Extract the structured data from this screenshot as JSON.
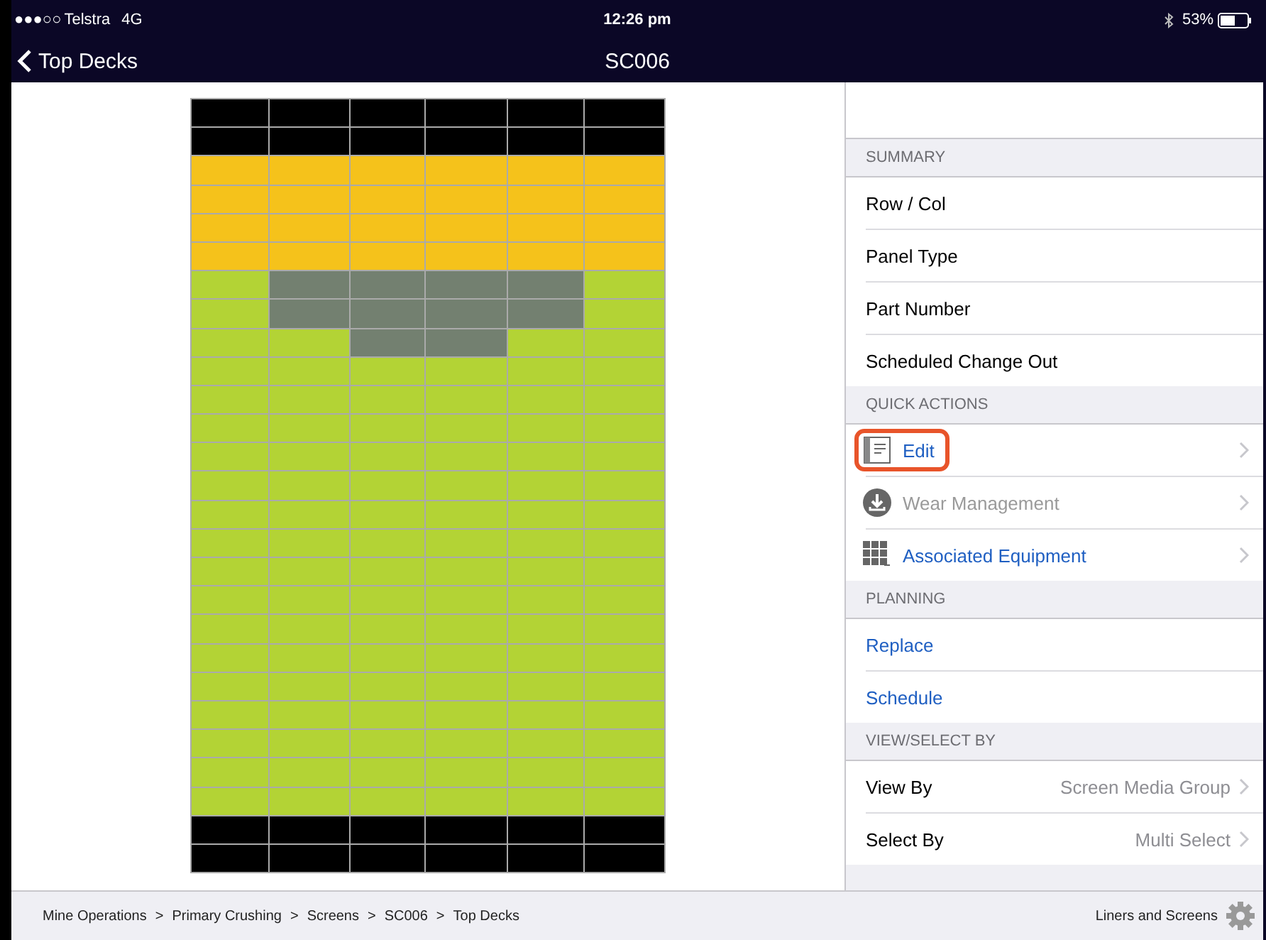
{
  "status_bar": {
    "signal": "●●●○○",
    "carrier": "Telstra",
    "network": "4G",
    "time": "12:26 pm",
    "battery": "53%"
  },
  "nav_bar": {
    "back": "Top Decks",
    "title": "SC006"
  },
  "deck_grid": {
    "rows": [
      {
        "cells": [
          {
            "color": "#000000"
          },
          {
            "color": "#000000"
          },
          {
            "color": "#000000"
          },
          {
            "color": "#000000"
          },
          {
            "color": "#000000"
          },
          {
            "color": "#000000"
          }
        ]
      },
      {
        "cells": [
          {
            "color": "#000000"
          },
          {
            "color": "#000000"
          },
          {
            "color": "#000000"
          },
          {
            "color": "#000000"
          },
          {
            "color": "#000000"
          },
          {
            "color": "#000000"
          }
        ]
      },
      {
        "cells": [
          {
            "color": "#f5c21b"
          },
          {
            "color": "#f5c21b"
          },
          {
            "color": "#f5c21b"
          },
          {
            "color": "#f5c21b"
          },
          {
            "color": "#f5c21b"
          },
          {
            "color": "#f5c21b"
          }
        ]
      },
      {
        "cells": [
          {
            "color": "#f5c21b"
          },
          {
            "color": "#f5c21b"
          },
          {
            "color": "#f5c21b"
          },
          {
            "color": "#f5c21b"
          },
          {
            "color": "#f5c21b"
          },
          {
            "color": "#f5c21b"
          }
        ]
      },
      {
        "cells": [
          {
            "color": "#f5c21b"
          },
          {
            "color": "#f5c21b"
          },
          {
            "color": "#f5c21b"
          },
          {
            "color": "#f5c21b"
          },
          {
            "color": "#f5c21b"
          },
          {
            "color": "#f5c21b"
          }
        ]
      },
      {
        "cells": [
          {
            "color": "#f5c21b"
          },
          {
            "color": "#f5c21b"
          },
          {
            "color": "#f5c21b"
          },
          {
            "color": "#f5c21b"
          },
          {
            "color": "#f5c21b"
          },
          {
            "color": "#f5c21b"
          }
        ]
      },
      {
        "cells": [
          {
            "color": "#b3d335"
          },
          {
            "color": "#738070"
          },
          {
            "color": "#738070"
          },
          {
            "color": "#738070"
          },
          {
            "color": "#738070"
          },
          {
            "color": "#b3d335"
          }
        ]
      },
      {
        "cells": [
          {
            "color": "#b3d335"
          },
          {
            "color": "#738070"
          },
          {
            "color": "#738070"
          },
          {
            "color": "#738070"
          },
          {
            "color": "#738070"
          },
          {
            "color": "#b3d335"
          }
        ]
      },
      {
        "cells": [
          {
            "color": "#b3d335"
          },
          {
            "color": "#b3d335"
          },
          {
            "color": "#738070"
          },
          {
            "color": "#738070"
          },
          {
            "color": "#b3d335"
          },
          {
            "color": "#b3d335"
          }
        ]
      },
      {
        "cells": [
          {
            "color": "#b3d335"
          },
          {
            "color": "#b3d335"
          },
          {
            "color": "#b3d335"
          },
          {
            "color": "#b3d335"
          },
          {
            "color": "#b3d335"
          },
          {
            "color": "#b3d335"
          }
        ]
      },
      {
        "cells": [
          {
            "color": "#b3d335"
          },
          {
            "color": "#b3d335"
          },
          {
            "color": "#b3d335"
          },
          {
            "color": "#b3d335"
          },
          {
            "color": "#b3d335"
          },
          {
            "color": "#b3d335"
          }
        ]
      },
      {
        "cells": [
          {
            "color": "#b3d335"
          },
          {
            "color": "#b3d335"
          },
          {
            "color": "#b3d335"
          },
          {
            "color": "#b3d335"
          },
          {
            "color": "#b3d335"
          },
          {
            "color": "#b3d335"
          }
        ]
      },
      {
        "cells": [
          {
            "color": "#b3d335"
          },
          {
            "color": "#b3d335"
          },
          {
            "color": "#b3d335"
          },
          {
            "color": "#b3d335"
          },
          {
            "color": "#b3d335"
          },
          {
            "color": "#b3d335"
          }
        ]
      },
      {
        "cells": [
          {
            "color": "#b3d335"
          },
          {
            "color": "#b3d335"
          },
          {
            "color": "#b3d335"
          },
          {
            "color": "#b3d335"
          },
          {
            "color": "#b3d335"
          },
          {
            "color": "#b3d335"
          }
        ]
      },
      {
        "cells": [
          {
            "color": "#b3d335"
          },
          {
            "color": "#b3d335"
          },
          {
            "color": "#b3d335"
          },
          {
            "color": "#b3d335"
          },
          {
            "color": "#b3d335"
          },
          {
            "color": "#b3d335"
          }
        ]
      },
      {
        "cells": [
          {
            "color": "#b3d335"
          },
          {
            "color": "#b3d335"
          },
          {
            "color": "#b3d335"
          },
          {
            "color": "#b3d335"
          },
          {
            "color": "#b3d335"
          },
          {
            "color": "#b3d335"
          }
        ]
      },
      {
        "cells": [
          {
            "color": "#b3d335"
          },
          {
            "color": "#b3d335"
          },
          {
            "color": "#b3d335"
          },
          {
            "color": "#b3d335"
          },
          {
            "color": "#b3d335"
          },
          {
            "color": "#b3d335"
          }
        ]
      },
      {
        "cells": [
          {
            "color": "#b3d335"
          },
          {
            "color": "#b3d335"
          },
          {
            "color": "#b3d335"
          },
          {
            "color": "#b3d335"
          },
          {
            "color": "#b3d335"
          },
          {
            "color": "#b3d335"
          }
        ]
      },
      {
        "cells": [
          {
            "color": "#b3d335"
          },
          {
            "color": "#b3d335"
          },
          {
            "color": "#b3d335"
          },
          {
            "color": "#b3d335"
          },
          {
            "color": "#b3d335"
          },
          {
            "color": "#b3d335"
          }
        ]
      },
      {
        "cells": [
          {
            "color": "#b3d335"
          },
          {
            "color": "#b3d335"
          },
          {
            "color": "#b3d335"
          },
          {
            "color": "#b3d335"
          },
          {
            "color": "#b3d335"
          },
          {
            "color": "#b3d335"
          }
        ]
      },
      {
        "cells": [
          {
            "color": "#b3d335"
          },
          {
            "color": "#b3d335"
          },
          {
            "color": "#b3d335"
          },
          {
            "color": "#b3d335"
          },
          {
            "color": "#b3d335"
          },
          {
            "color": "#b3d335"
          }
        ]
      },
      {
        "cells": [
          {
            "color": "#b3d335"
          },
          {
            "color": "#b3d335"
          },
          {
            "color": "#b3d335"
          },
          {
            "color": "#b3d335"
          },
          {
            "color": "#b3d335"
          },
          {
            "color": "#b3d335"
          }
        ]
      },
      {
        "cells": [
          {
            "color": "#b3d335"
          },
          {
            "color": "#b3d335"
          },
          {
            "color": "#b3d335"
          },
          {
            "color": "#b3d335"
          },
          {
            "color": "#b3d335"
          },
          {
            "color": "#b3d335"
          }
        ]
      },
      {
        "cells": [
          {
            "color": "#b3d335"
          },
          {
            "color": "#b3d335"
          },
          {
            "color": "#b3d335"
          },
          {
            "color": "#b3d335"
          },
          {
            "color": "#b3d335"
          },
          {
            "color": "#b3d335"
          }
        ]
      },
      {
        "cells": [
          {
            "color": "#b3d335"
          },
          {
            "color": "#b3d335"
          },
          {
            "color": "#b3d335"
          },
          {
            "color": "#b3d335"
          },
          {
            "color": "#b3d335"
          },
          {
            "color": "#b3d335"
          }
        ]
      },
      {
        "cells": [
          {
            "color": "#000000"
          },
          {
            "color": "#000000"
          },
          {
            "color": "#000000"
          },
          {
            "color": "#000000"
          },
          {
            "color": "#000000"
          },
          {
            "color": "#000000"
          }
        ]
      },
      {
        "cells": [
          {
            "color": "#000000"
          },
          {
            "color": "#000000"
          },
          {
            "color": "#000000"
          },
          {
            "color": "#000000"
          },
          {
            "color": "#000000"
          },
          {
            "color": "#000000"
          }
        ]
      }
    ]
  },
  "sections": [
    {
      "header": "SUMMARY",
      "rows": [
        {
          "kind": "plain",
          "label": "Row / Col"
        },
        {
          "kind": "plain",
          "label": "Panel Type"
        },
        {
          "kind": "plain",
          "label": "Part Number"
        },
        {
          "kind": "plain",
          "label": "Scheduled Change Out"
        }
      ]
    },
    {
      "header": "QUICK ACTIONS",
      "rows": [
        {
          "kind": "action",
          "label": "Edit",
          "disabled": false,
          "highlighted": true
        },
        {
          "kind": "action",
          "label": "Wear Management",
          "disabled": true,
          "highlighted": false
        },
        {
          "kind": "action",
          "label": "Associated Equipment",
          "disabled": false,
          "highlighted": false
        }
      ]
    },
    {
      "header": "PLANNING",
      "rows": [
        {
          "kind": "link",
          "label": "Replace"
        },
        {
          "kind": "link",
          "label": "Schedule"
        }
      ]
    },
    {
      "header": "VIEW/SELECT BY",
      "rows": [
        {
          "kind": "value",
          "label": "View By",
          "value": "Screen Media Group"
        },
        {
          "kind": "value",
          "label": "Select By",
          "value": "Multi Select"
        }
      ]
    }
  ],
  "footer": {
    "breadcrumb": [
      "Mine Operations",
      "Primary Crushing",
      "Screens",
      "SC006",
      "Top Decks"
    ],
    "separator": ">",
    "module": "Liners and Screens"
  }
}
